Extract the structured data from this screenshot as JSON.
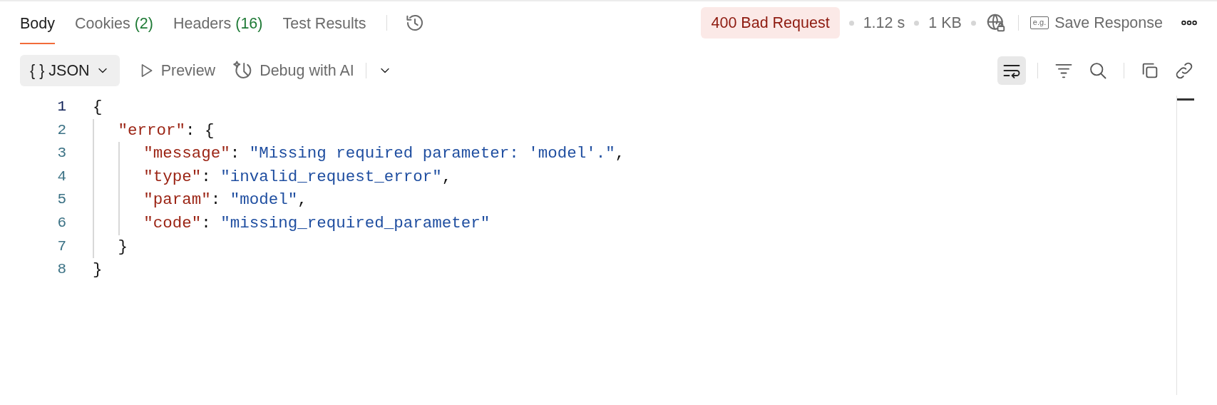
{
  "tabs": [
    {
      "label": "Body",
      "selected": true
    },
    {
      "label": "Cookies",
      "count": "(2)",
      "selected": false
    },
    {
      "label": "Headers",
      "count": "(16)",
      "selected": false
    },
    {
      "label": "Test Results",
      "selected": false
    }
  ],
  "status": {
    "label": "400 Bad Request",
    "kind": "error"
  },
  "time": "1.12 s",
  "size": "1 KB",
  "save_response": {
    "icon_text": "e.g.",
    "label": "Save Response"
  },
  "format": {
    "glyph": "{ }",
    "label": "JSON"
  },
  "preview": "Preview",
  "debug": "Debug with AI",
  "tool_groups": [
    [
      {
        "kind": "wrap",
        "on": true
      }
    ],
    [
      {
        "kind": "filter",
        "on": false
      },
      {
        "kind": "search",
        "on": false
      }
    ],
    [
      {
        "kind": "copy",
        "on": false
      },
      {
        "kind": "link",
        "on": false
      }
    ]
  ],
  "code_lines": [
    {
      "number": "1",
      "current": true,
      "tokens": [
        {
          "kind": "punct",
          "text": "{"
        }
      ]
    },
    {
      "number": "2",
      "current": false,
      "tokens": [
        {
          "kind": "key",
          "text": "\"error\""
        },
        {
          "kind": "punct",
          "text": ": {"
        }
      ]
    },
    {
      "number": "3",
      "current": false,
      "tokens": [
        {
          "kind": "key",
          "text": "\"message\""
        },
        {
          "kind": "punct",
          "text": ": "
        },
        {
          "kind": "string",
          "text": "\"Missing required parameter: 'model'.\""
        },
        {
          "kind": "punct",
          "text": ","
        }
      ]
    },
    {
      "number": "4",
      "current": false,
      "tokens": [
        {
          "kind": "key",
          "text": "\"type\""
        },
        {
          "kind": "punct",
          "text": ": "
        },
        {
          "kind": "string",
          "text": "\"invalid_request_error\""
        },
        {
          "kind": "punct",
          "text": ","
        }
      ]
    },
    {
      "number": "5",
      "current": false,
      "tokens": [
        {
          "kind": "key",
          "text": "\"param\""
        },
        {
          "kind": "punct",
          "text": ": "
        },
        {
          "kind": "string",
          "text": "\"model\""
        },
        {
          "kind": "punct",
          "text": ","
        }
      ]
    },
    {
      "number": "6",
      "current": false,
      "tokens": [
        {
          "kind": "key",
          "text": "\"code\""
        },
        {
          "kind": "punct",
          "text": ": "
        },
        {
          "kind": "string",
          "text": "\"missing_required_parameter\""
        }
      ]
    },
    {
      "number": "7",
      "current": false,
      "tokens": [
        {
          "kind": "punct",
          "text": "}"
        }
      ]
    },
    {
      "number": "8",
      "current": false,
      "tokens": [
        {
          "kind": "punct",
          "text": "}"
        }
      ]
    }
  ]
}
